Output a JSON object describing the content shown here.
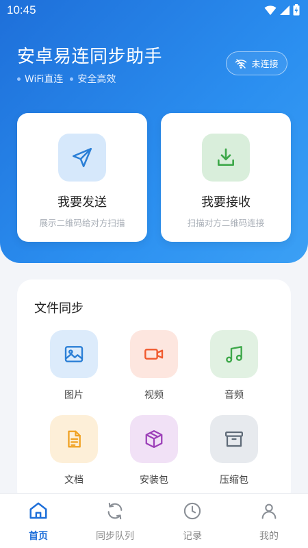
{
  "status_bar": {
    "time": "10:45"
  },
  "header": {
    "title": "安卓易连同步助手",
    "tags": [
      "WiFi直连",
      "安全高效"
    ],
    "connection_status": "未连接"
  },
  "actions": {
    "send": {
      "label": "我要发送",
      "sub": "展示二维码给对方扫描",
      "icon": "send-icon"
    },
    "receive": {
      "label": "我要接收",
      "sub": "扫描对方二维码连接",
      "icon": "download-icon"
    }
  },
  "file_sync": {
    "title": "文件同步",
    "categories": [
      {
        "label": "图片",
        "icon": "image-icon",
        "color": "#2b7fd6",
        "bg": "#dcebfb"
      },
      {
        "label": "视频",
        "icon": "video-icon",
        "color": "#f05a2e",
        "bg": "#fde6df"
      },
      {
        "label": "音频",
        "icon": "music-icon",
        "color": "#3ea84a",
        "bg": "#e1f1e2"
      },
      {
        "label": "文档",
        "icon": "document-icon",
        "color": "#f0a020",
        "bg": "#fdefd8"
      },
      {
        "label": "安装包",
        "icon": "package-icon",
        "color": "#9c3fb8",
        "bg": "#f1e1f6"
      },
      {
        "label": "压缩包",
        "icon": "archive-icon",
        "color": "#5f6b78",
        "bg": "#e7eaee"
      }
    ]
  },
  "tabbar": {
    "items": [
      {
        "label": "首页",
        "icon": "home-icon",
        "active": true
      },
      {
        "label": "同步队列",
        "icon": "sync-icon",
        "active": false
      },
      {
        "label": "记录",
        "icon": "clock-icon",
        "active": false
      },
      {
        "label": "我的",
        "icon": "user-icon",
        "active": false
      }
    ]
  },
  "colors": {
    "accent": "#1e6fd9",
    "hero_start": "#1e6fd9",
    "hero_end": "#3ba0f5"
  }
}
